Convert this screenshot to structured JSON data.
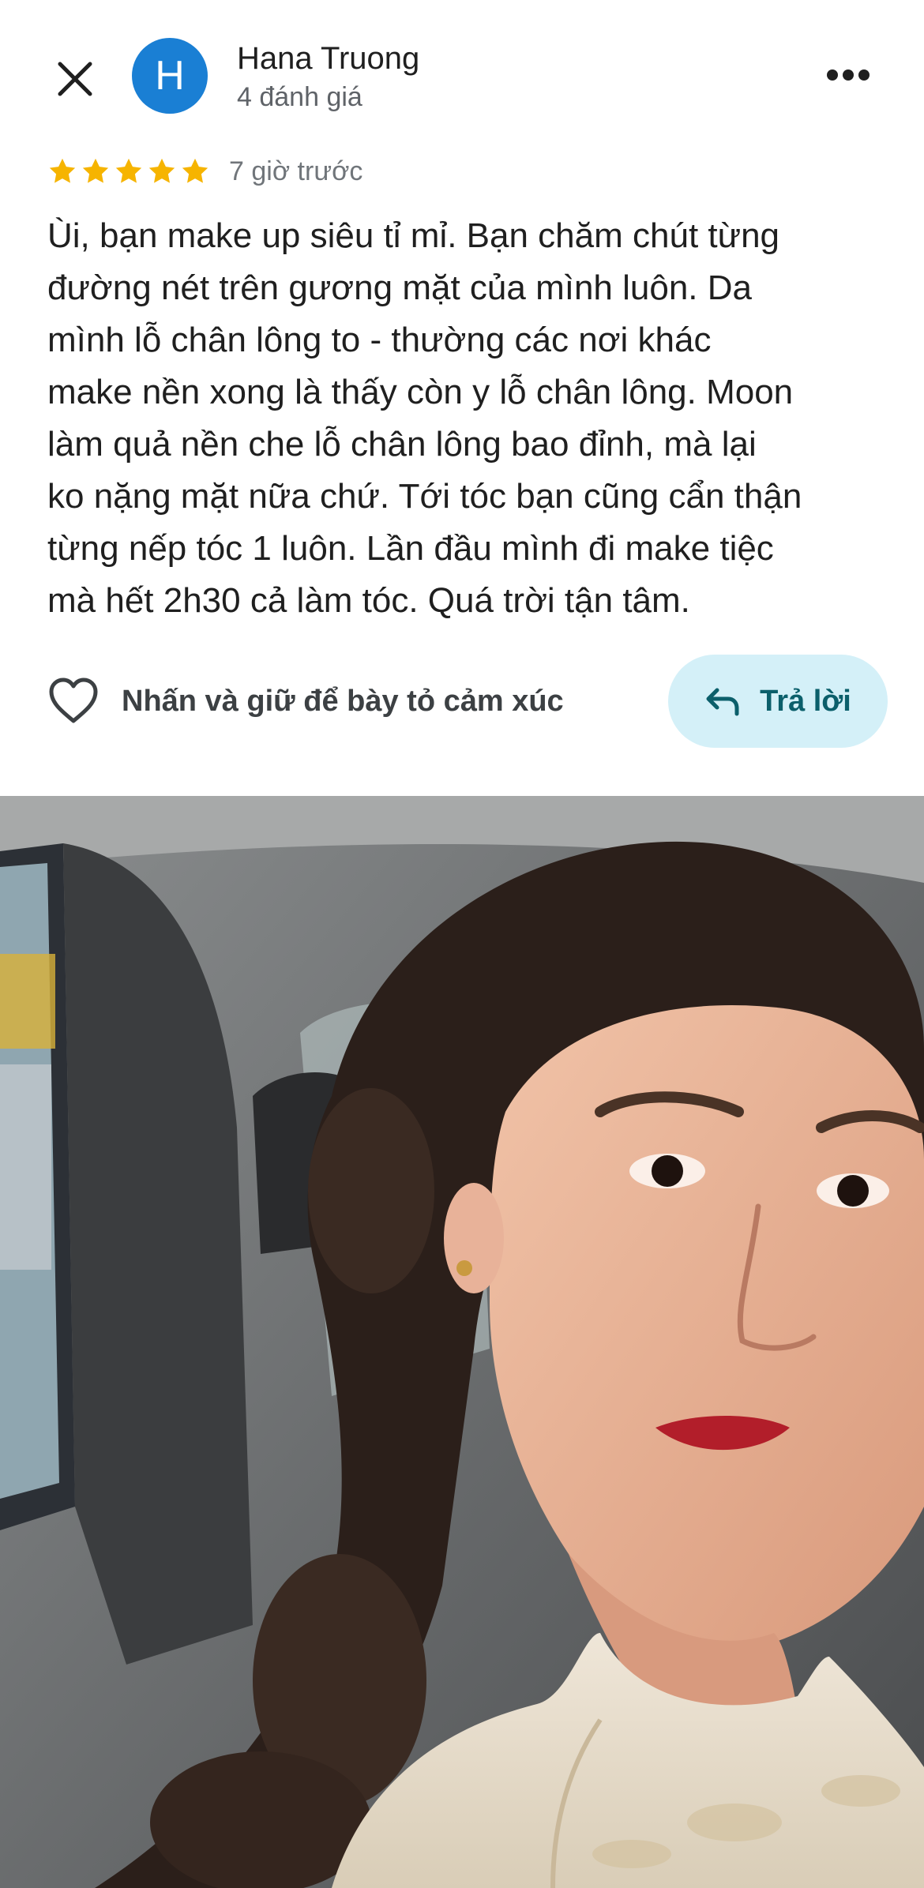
{
  "header": {
    "avatar_letter": "H",
    "reviewer_name": "Hana Truong",
    "review_count": "4 đánh giá",
    "close_icon": "close-icon",
    "more_icon": "more-horizontal-icon"
  },
  "review": {
    "rating": 5,
    "max_rating": 5,
    "time_ago": "7 giờ trước",
    "text": "Ùi, bạn make up siêu tỉ mỉ. Bạn chăm chút từng\nđường nét trên gương mặt của mình luôn.  Da\nmình lỗ chân lông to - thường các nơi khác\nmake nền xong là thấy còn y lỗ chân lông. Moon\nlàm quả nền che lỗ chân lông bao đỉnh, mà lại\nko nặng mặt nữa chứ. Tới tóc bạn cũng cẩn thận\ntừng nếp tóc 1 luôn. Lần đầu mình đi make tiệc\nmà hết 2h30 cả làm tóc. Quá trời tận tâm."
  },
  "actions": {
    "react_label": "Nhấn và giữ để bày tỏ cảm xúc",
    "react_icon": "heart-outline-icon",
    "reply_label": "Trả lời",
    "reply_icon": "reply-arrow-icon"
  },
  "colors": {
    "avatar_bg": "#1a7fd4",
    "star": "#f6b400",
    "reply_bg": "#d4f0f8",
    "reply_text": "#0b5f6b"
  }
}
